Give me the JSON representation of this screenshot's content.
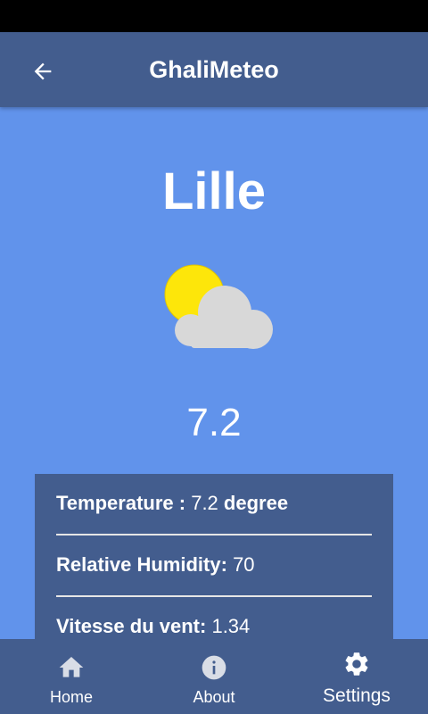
{
  "app_bar": {
    "title": "GhaliMeteo",
    "back_icon": "arrow-back-icon"
  },
  "weather": {
    "city": "Lille",
    "icon": "partly-cloudy-icon",
    "temperature_display": "7.2",
    "details": [
      {
        "label": "Temperature :",
        "value": "7.2",
        "suffix": "degree"
      },
      {
        "label": "Relative Humidity:",
        "value": "70",
        "suffix": ""
      },
      {
        "label": "Vitesse du vent:",
        "value": "1.34",
        "suffix": ""
      }
    ]
  },
  "bottom_nav": {
    "items": [
      {
        "label": "Home",
        "icon": "home-icon"
      },
      {
        "label": "About",
        "icon": "info-icon"
      },
      {
        "label": "Settings",
        "icon": "gear-icon",
        "selected": true
      }
    ]
  },
  "colors": {
    "background": "#6193eb",
    "bars": "#435d8e",
    "sun": "#fde60a",
    "cloud": "#d8d8d8",
    "text": "#ffffff"
  }
}
